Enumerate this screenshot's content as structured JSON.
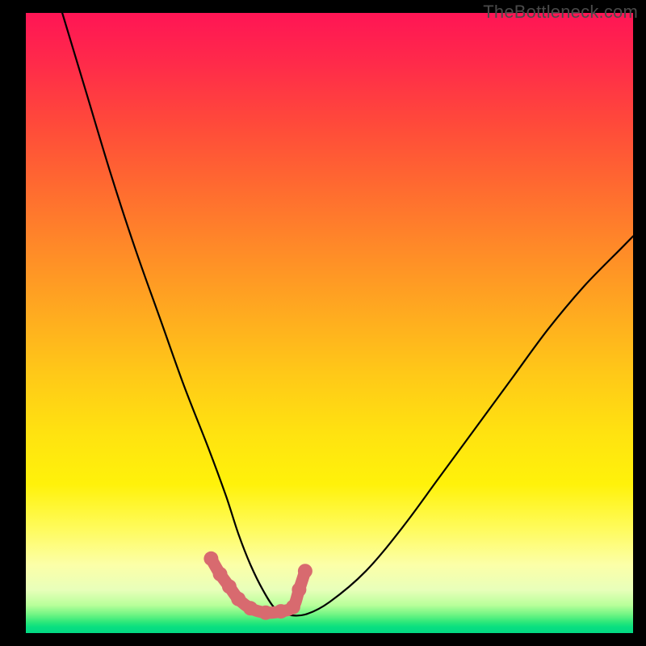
{
  "watermark": "TheBottleneck.com",
  "colors": {
    "background": "#000000",
    "curve": "#000000",
    "highlight": "#d86a6f"
  },
  "chart_data": {
    "type": "line",
    "title": "",
    "xlabel": "",
    "ylabel": "",
    "xlim": [
      0,
      100
    ],
    "ylim": [
      0,
      100
    ],
    "series": [
      {
        "name": "bottleneck-curve",
        "x": [
          6,
          10,
          14,
          18,
          22,
          26,
          30,
          33,
          35,
          37,
          39,
          41,
          43,
          46,
          50,
          56,
          62,
          68,
          74,
          80,
          86,
          92,
          98,
          100
        ],
        "y": [
          100,
          87,
          74,
          62,
          51,
          40,
          30,
          22,
          16,
          11,
          7,
          4,
          3,
          3,
          5,
          10,
          17,
          25,
          33,
          41,
          49,
          56,
          62,
          64
        ]
      }
    ],
    "highlighted_points": {
      "name": "near-bottom-segment",
      "x": [
        30.5,
        32.0,
        33.5,
        35.0,
        37.0,
        39.5,
        42.0,
        44.0,
        45.0,
        46.0
      ],
      "y": [
        12.0,
        9.5,
        7.5,
        5.5,
        4.0,
        3.3,
        3.5,
        4.2,
        7.0,
        10.0
      ]
    }
  }
}
